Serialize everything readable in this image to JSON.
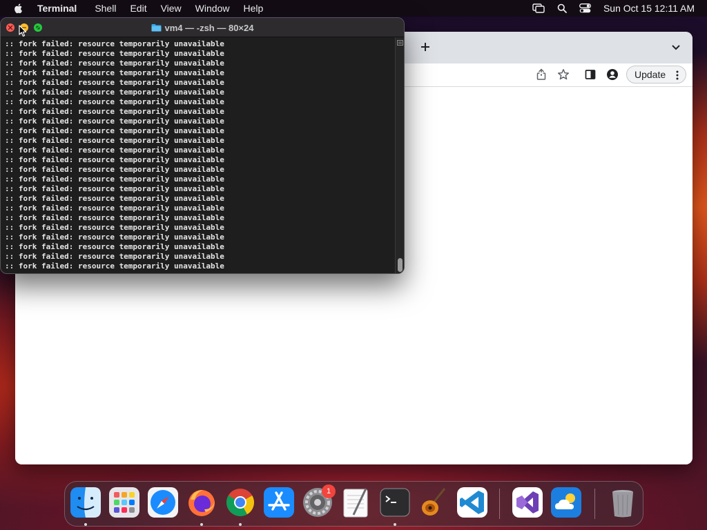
{
  "menubar": {
    "app_name": "Terminal",
    "items": [
      "Shell",
      "Edit",
      "View",
      "Window",
      "Help"
    ],
    "clock": "Sun Oct 15  12:11 AM"
  },
  "terminal": {
    "title": "vm4 — -zsh — 80×24",
    "line": ":: fork failed: resource temporarily unavailable",
    "lines": [
      ":: fork failed: resource temporarily unavailable",
      ":: fork failed: resource temporarily unavailable",
      ":: fork failed: resource temporarily unavailable",
      ":: fork failed: resource temporarily unavailable",
      ":: fork failed: resource temporarily unavailable",
      ":: fork failed: resource temporarily unavailable",
      ":: fork failed: resource temporarily unavailable",
      ":: fork failed: resource temporarily unavailable",
      ":: fork failed: resource temporarily unavailable",
      ":: fork failed: resource temporarily unavailable",
      ":: fork failed: resource temporarily unavailable",
      ":: fork failed: resource temporarily unavailable",
      ":: fork failed: resource temporarily unavailable",
      ":: fork failed: resource temporarily unavailable",
      ":: fork failed: resource temporarily unavailable",
      ":: fork failed: resource temporarily unavailable",
      ":: fork failed: resource temporarily unavailable",
      ":: fork failed: resource temporarily unavailable",
      ":: fork failed: resource temporarily unavailable",
      ":: fork failed: resource temporarily unavailable",
      ":: fork failed: resource temporarily unavailable",
      ":: fork failed: resource temporarily unavailable",
      ":: fork failed: resource temporarily unavailable",
      ":: fork failed: resource temporarily unavailable"
    ]
  },
  "chrome": {
    "update_label": "Update"
  },
  "dock": {
    "apps": [
      "finder",
      "launchpad",
      "safari",
      "firefox",
      "chrome",
      "app-store",
      "system-settings",
      "textedit",
      "terminal",
      "garageband",
      "vscode",
      "visual-studio",
      "weather",
      "trash"
    ],
    "settings_badge": "1"
  },
  "colors": {
    "close": "#ff5f57",
    "minimize": "#febc2e",
    "zoom": "#28c840",
    "badge": "#f2453d"
  }
}
